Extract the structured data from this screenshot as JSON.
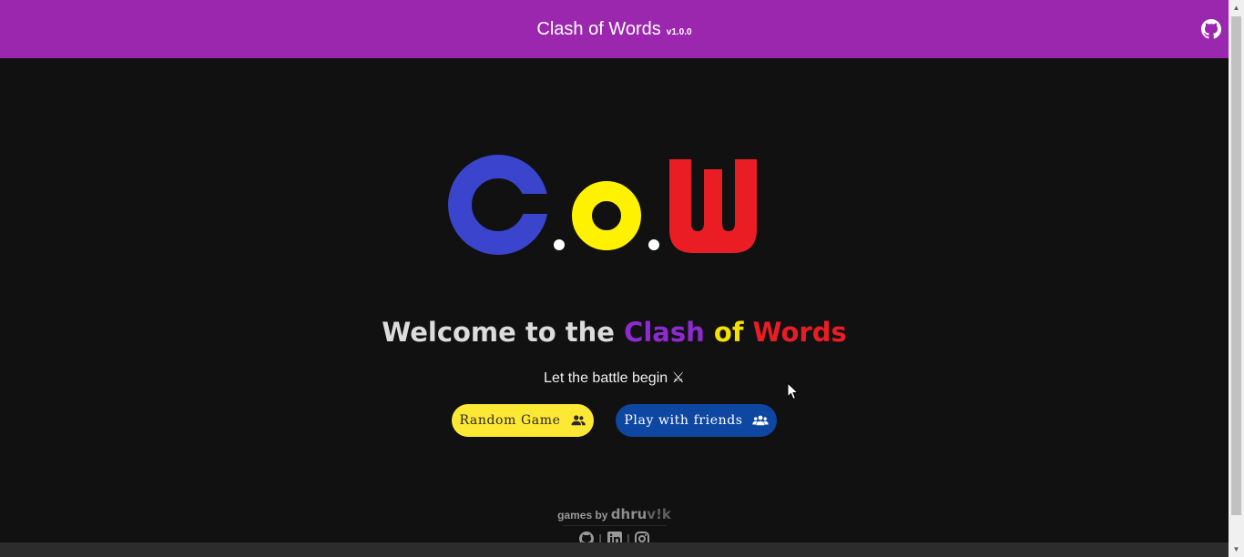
{
  "header": {
    "title": "Clash of Words",
    "version": "v1.0.0",
    "github_icon": "github-icon"
  },
  "logo": {
    "letters": [
      "C",
      "o",
      "W"
    ],
    "colors": [
      "#3a44cc",
      "#fff200",
      "#ea1d25"
    ]
  },
  "welcome": {
    "prefix": "Welcome to the",
    "word1": "Clash",
    "word2": "of",
    "word3": "Words"
  },
  "subtitle": "Let the battle begin ⚔",
  "buttons": {
    "random_label": "Random Game",
    "random_icon": "users-icon",
    "friends_label": "Play with friends",
    "friends_icon": "user-group-icon"
  },
  "footer": {
    "by_text": "games by",
    "brand_main": "dhru",
    "brand_tail": "v!k",
    "social": [
      "github-icon",
      "linkedin-icon",
      "instagram-icon"
    ],
    "separator": "|"
  },
  "colors": {
    "header_bg": "#9b27af",
    "page_bg": "#111112",
    "random_bg": "#fde834",
    "friends_bg": "#0e47a1"
  }
}
